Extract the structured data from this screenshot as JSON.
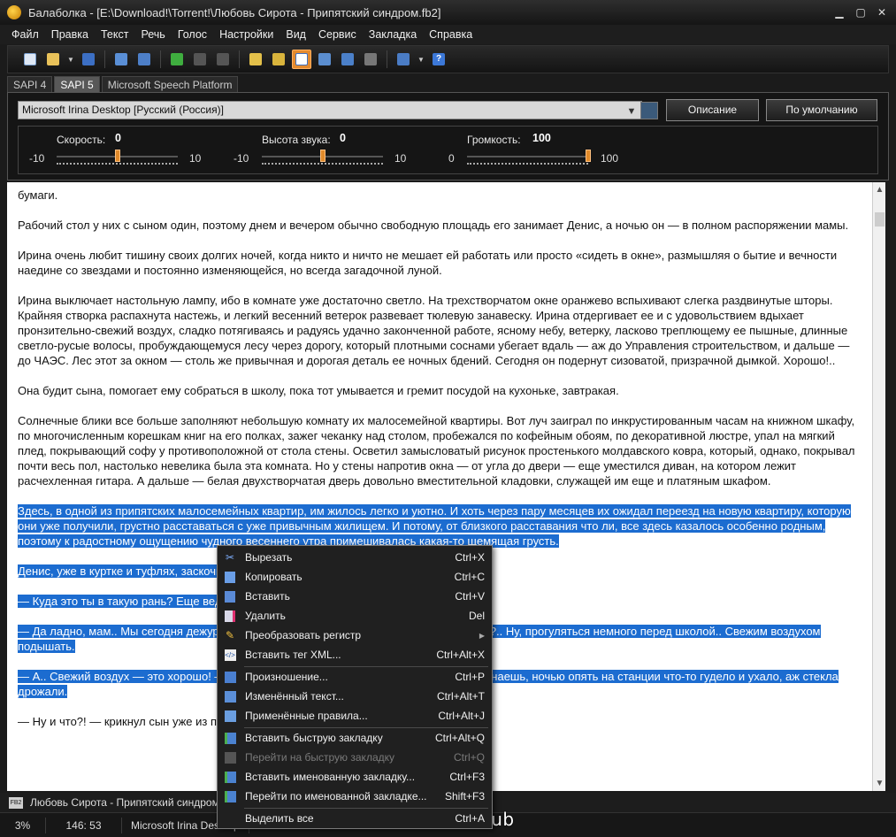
{
  "window": {
    "title": "Балаболка - [E:\\Download!\\Torrent!\\Любовь Сирота - Припятский синдром.fb2]",
    "controls": [
      "minimize-icon",
      "maximize-icon",
      "close-icon"
    ]
  },
  "menu": [
    "Файл",
    "Правка",
    "Текст",
    "Речь",
    "Голос",
    "Настройки",
    "Вид",
    "Сервис",
    "Закладка",
    "Справка"
  ],
  "toolbar": {
    "icons": [
      "new-file-icon",
      "open-folder-icon",
      "dropdown-arrow-icon",
      "save-icon",
      "read-clipboard-icon",
      "read-selection-icon",
      "play-icon",
      "pause-icon",
      "stop-icon",
      "split-icon",
      "convert-icon",
      "pronunciation-icon",
      "dictionary-icon",
      "batch-icon",
      "files-icon",
      "export-icon",
      "dropdown-arrow-icon",
      "help-icon"
    ]
  },
  "tabs": [
    "SAPI 4",
    "SAPI 5",
    "Microsoft Speech Platform"
  ],
  "selected_tab": "SAPI 5",
  "voice": {
    "selected": "Microsoft Irina Desktop [Русский (Россия)]",
    "describe_label": "Описание",
    "default_label": "По умолчанию"
  },
  "params": {
    "rate": {
      "label": "Скорость:",
      "value": "0",
      "min": "-10",
      "max": "10",
      "level": 0.5
    },
    "pitch": {
      "label": "Высота звука:",
      "value": "0",
      "min": "-10",
      "max": "10",
      "level": 0.5
    },
    "volume": {
      "label": "Громкость:",
      "value": "100",
      "min": "0",
      "max": "100",
      "level": 1.0
    }
  },
  "text": {
    "p0": "бумаги.",
    "p1": "Рабочий стол у них с сыном один, поэтому днем и вечером обычно свободную площадь его занимает Денис, а ночью он — в полном распоряжении мамы.",
    "p2": "Ирина очень любит тишину своих долгих ночей, когда никто и ничто не мешает ей работать или просто «сидеть в окне», размышляя о бытие и вечности наедине со звездами и постоянно изменяющейся, но всегда загадочной луной.",
    "p3": "Ирина выключает настольную лампу, ибо в комнате уже достаточно светло. На трехстворчатом окне оранжево вспыхивают слегка раздвинутые шторы. Крайняя створка распахнута настежь, и легкий весенний ветерок развевает тюлевую занавеску. Ирина отдергивает ее и с удовольствием вдыхает пронзительно-свежий воздух, сладко потягиваясь и радуясь удачно законченной работе, ясному небу, ветерку, ласково треплющему ее пышные, длинные светло-русые волосы, пробуждающемуся лесу через дорогу, который плотными соснами убегает вдаль — аж до Управления строительством, и дальше — до ЧАЭС. Лес этот за окном — столь же привычная и дорогая деталь ее ночных бдений. Сегодня он подернут сизоватой, призрачной дымкой. Хорошо!..",
    "p4": "Она будит сына, помогает ему собраться в школу, пока тот умывается и гремит посудой на кухоньке, завтракая.",
    "p5": "Солнечные блики все больше заполняют небольшую комнату их малосемейной квартиры. Вот луч заиграл по инкрустированным часам на книжном шкафу, по многочисленным корешкам книг на его полках, зажег чеканку над столом, пробежался по кофейным обоям, по декоративной люстре, упал на мягкий плед, покрывающий софу у противоположной от стола стены. Осветил замысловатый рисунок простенького молдавского ковра, который, однако, покрывал почти весь пол, настолько невелика была эта комната. Но у стены напротив окна — от угла до двери — еще уместился диван, на котором лежит расчехленная гитара. А дальше — белая двухстворчатая дверь довольно вместительной кладовки, служащей им еще и платяным шкафом.",
    "p6": "Здесь, в одной из припятских малосемейных квартир, им жилось легко и уютно. И хоть через пару месяцев их ожидал переезд на новую квартиру, которую они уже получили, грустно расставаться с уже привычным жилищем. И потому, от близкого расставания что ли, все здесь казалось особенно родным, поэтому к радостному ощущению чудного весеннего утра примешивалась какая-то щемящая грусть.",
    "p7": "Денис, уже в куртке и туфлях, заскочил в комнату. Мама удивилась такой прыти:",
    "p8": "— Куда это ты в такую рань? Еще ведь рано!",
    "p9": "— Да ладно, мам.. Мы сегодня дежурим, да и с ребятами так договорились, понимаешь?.. Ну, прогуляться немного перед школой.. Свежим воздухом подышать.",
    "p10": "— А.. Свежий воздух — это хорошо! — говорит мама и вдруг вспоминает она, — Деня, знаешь, ночью опять на станции что-то гудело и ухало, аж стекла дрожали.",
    "p11": "— Ну и что?! — крикнул сын уже из прихожей."
  },
  "status": {
    "document": "Любовь Сирота - Припятский синдром.fb2",
    "percent": "3%",
    "position": "146:  53",
    "voice": "Microsoft Irina Desktop"
  },
  "context_menu": [
    {
      "label": "Вырезать",
      "shortcut": "Ctrl+X",
      "icon": "scissors-icon"
    },
    {
      "label": "Копировать",
      "shortcut": "Ctrl+C",
      "icon": "copy-icon"
    },
    {
      "label": "Вставить",
      "shortcut": "Ctrl+V",
      "icon": "paste-icon"
    },
    {
      "label": "Удалить",
      "shortcut": "Del",
      "icon": "delete-icon"
    },
    {
      "label": "Преобразовать регистр",
      "shortcut": "",
      "icon": "pencil-icon"
    },
    {
      "label": "Вставить тег XML...",
      "shortcut": "Ctrl+Alt+X",
      "icon": "xml-tag-icon"
    },
    {
      "label": "Произношение...",
      "shortcut": "Ctrl+P",
      "icon": "pronunciation-icon"
    },
    {
      "label": "Изменённый текст...",
      "shortcut": "Ctrl+Alt+T",
      "icon": "changed-text-icon"
    },
    {
      "label": "Применённые правила...",
      "shortcut": "Ctrl+Alt+J",
      "icon": "rules-icon"
    },
    {
      "label": "Вставить быструю закладку",
      "shortcut": "Ctrl+Alt+Q",
      "icon": "quick-bookmark-icon"
    },
    {
      "label": "Перейти на быструю закладку",
      "shortcut": "Ctrl+Q",
      "icon": "goto-quick-bookmark-icon"
    },
    {
      "label": "Вставить именованную закладку...",
      "shortcut": "Ctrl+F3",
      "icon": "named-bookmark-icon"
    },
    {
      "label": "Перейти по именованной закладке...",
      "shortcut": "Shift+F3",
      "icon": "goto-named-bookmark-icon"
    },
    {
      "label": "Выделить все",
      "shortcut": "Ctrl+A",
      "icon": ""
    }
  ],
  "watermark": "NoNaMe-Club",
  "colors": {
    "accent": "#e48a2e",
    "selection": "#1c6cd0"
  }
}
